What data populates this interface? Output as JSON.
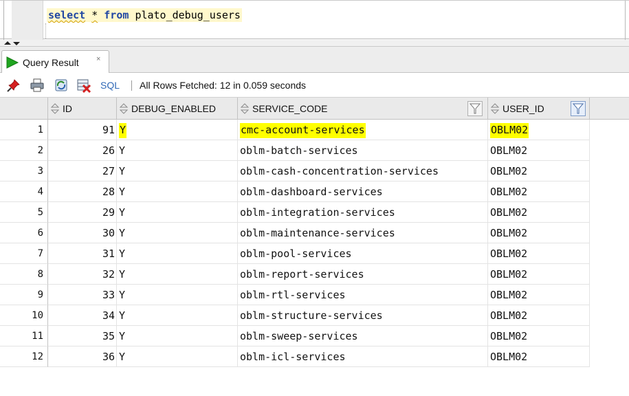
{
  "editor": {
    "kw_select": "select",
    "star": "*",
    "kw_from": "from",
    "table": "plato_debug_users"
  },
  "tab": {
    "label": "Query Result",
    "close": "×"
  },
  "toolbar": {
    "sql_label": "SQL",
    "status": "All Rows Fetched: 12 in 0.059 seconds",
    "icons": [
      "pin-icon",
      "print-icon",
      "refresh-icon",
      "cancel-query-icon"
    ]
  },
  "grid": {
    "columns": [
      "ID",
      "DEBUG_ENABLED",
      "SERVICE_CODE",
      "USER_ID"
    ],
    "rows": [
      {
        "n": "1",
        "id": "91",
        "debug": "Y",
        "service": "cmc-account-services",
        "user": "OBLM02"
      },
      {
        "n": "2",
        "id": "26",
        "debug": "Y",
        "service": "oblm-batch-services",
        "user": "OBLM02"
      },
      {
        "n": "3",
        "id": "27",
        "debug": "Y",
        "service": "oblm-cash-concentration-services",
        "user": "OBLM02"
      },
      {
        "n": "4",
        "id": "28",
        "debug": "Y",
        "service": "oblm-dashboard-services",
        "user": "OBLM02"
      },
      {
        "n": "5",
        "id": "29",
        "debug": "Y",
        "service": "oblm-integration-services",
        "user": "OBLM02"
      },
      {
        "n": "6",
        "id": "30",
        "debug": "Y",
        "service": "oblm-maintenance-services",
        "user": "OBLM02"
      },
      {
        "n": "7",
        "id": "31",
        "debug": "Y",
        "service": "oblm-pool-services",
        "user": "OBLM02"
      },
      {
        "n": "8",
        "id": "32",
        "debug": "Y",
        "service": "oblm-report-services",
        "user": "OBLM02"
      },
      {
        "n": "9",
        "id": "33",
        "debug": "Y",
        "service": "oblm-rtl-services",
        "user": "OBLM02"
      },
      {
        "n": "10",
        "id": "34",
        "debug": "Y",
        "service": "oblm-structure-services",
        "user": "OBLM02"
      },
      {
        "n": "11",
        "id": "35",
        "debug": "Y",
        "service": "oblm-sweep-services",
        "user": "OBLM02"
      },
      {
        "n": "12",
        "id": "36",
        "debug": "Y",
        "service": "oblm-icl-services",
        "user": "OBLM02"
      }
    ]
  },
  "colors": {
    "highlight": "#ffff00",
    "keyword": "#1f46a3",
    "sql_link": "#2f68b6",
    "run_green": "#1fa51f"
  }
}
